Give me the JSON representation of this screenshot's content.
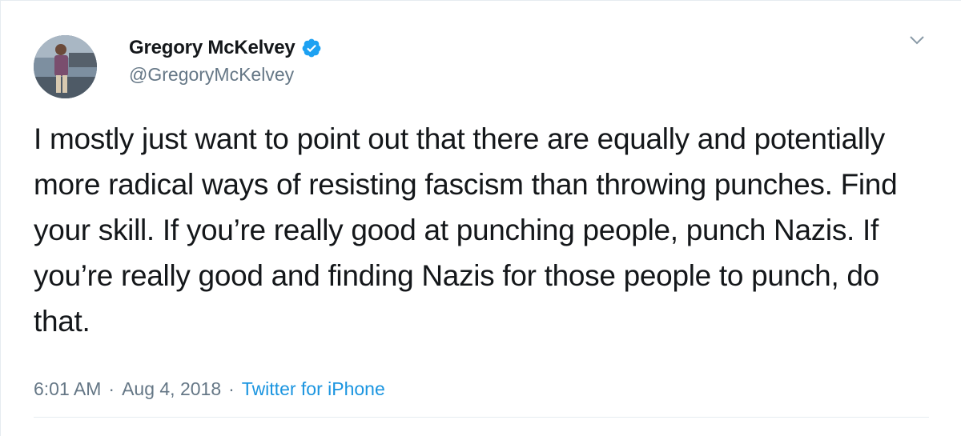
{
  "user": {
    "display_name": "Gregory McKelvey",
    "handle": "@GregoryMcKelvey",
    "verified": true
  },
  "tweet": {
    "text": "I mostly just want to point out that there are equally and potentially more radical ways of resisting fascism than throwing punches. Find your skill. If you’re really good at punching people, punch Nazis. If you’re really good and finding Nazis for those people to punch, do that.",
    "time": "6:01 AM",
    "separator": "·",
    "date": "Aug 4, 2018",
    "source": "Twitter for iPhone"
  },
  "icons": {
    "verified": "verified-badge-icon",
    "menu": "chevron-down-icon"
  },
  "colors": {
    "accent": "#1da1f2",
    "link": "#1b95e0",
    "text": "#14171a",
    "secondary": "#657786",
    "border": "#e6ecf0"
  }
}
